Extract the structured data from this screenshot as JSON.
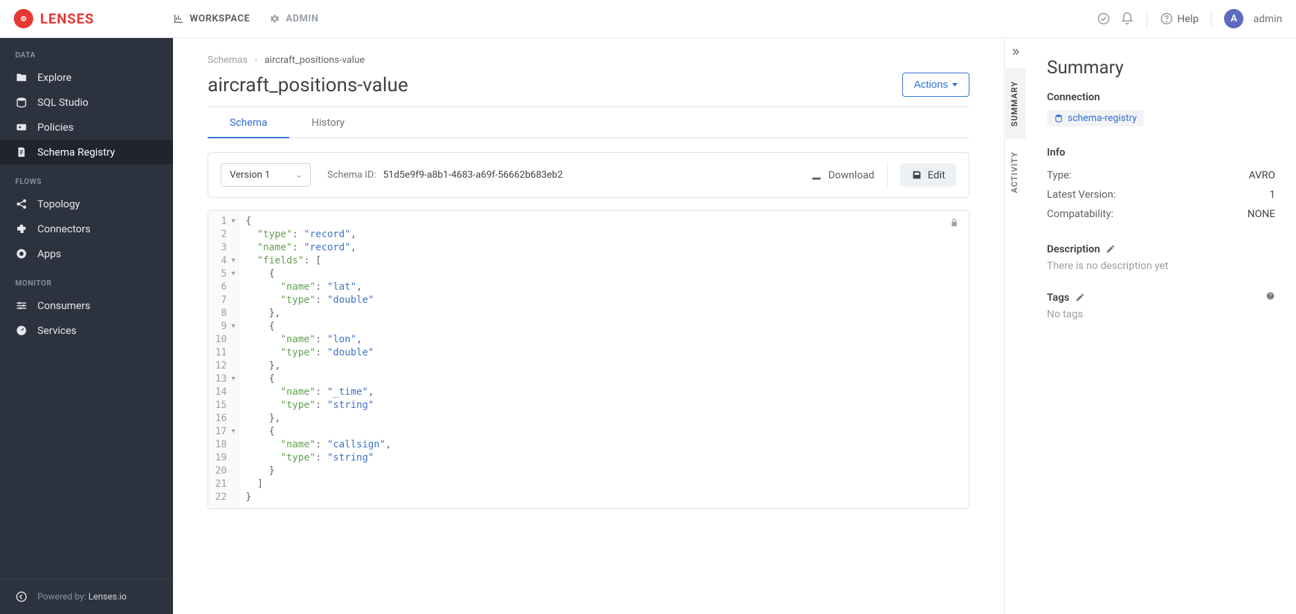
{
  "brand": "LENSES",
  "topnav": {
    "workspace": "WORKSPACE",
    "admin": "ADMIN"
  },
  "topright": {
    "help": "Help",
    "avatar_initial": "A",
    "username": "admin"
  },
  "sidebar": {
    "sections": {
      "data": {
        "title": "DATA",
        "explore": "Explore",
        "sql": "SQL Studio",
        "policies": "Policies",
        "schema": "Schema Registry"
      },
      "flows": {
        "title": "FLOWS",
        "topology": "Topology",
        "connectors": "Connectors",
        "apps": "Apps"
      },
      "monitor": {
        "title": "MONITOR",
        "consumers": "Consumers",
        "services": "Services"
      }
    },
    "footer": {
      "powered": "Powered by: ",
      "brand": "Lenses.io"
    }
  },
  "breadcrumb": {
    "root": "Schemas",
    "current": "aircraft_positions-value"
  },
  "title": "aircraft_positions-value",
  "actions_label": "Actions",
  "tabs": {
    "schema": "Schema",
    "history": "History"
  },
  "toolbar": {
    "version_label": "Version 1",
    "schema_id_label": "Schema ID:",
    "schema_id_value": "51d5e9f9-a8b1-4683-a69f-56662b683eb2",
    "download": "Download",
    "edit": "Edit"
  },
  "rail": {
    "summary": "SUMMARY",
    "activity": "ACTIVITY"
  },
  "panel": {
    "heading": "Summary",
    "connection_label": "Connection",
    "connection_value": "schema-registry",
    "info_label": "Info",
    "info": {
      "type_k": "Type:",
      "type_v": "AVRO",
      "latest_k": "Latest Version:",
      "latest_v": "1",
      "compat_k": "Compatability:",
      "compat_v": "NONE"
    },
    "description_label": "Description",
    "description_empty": "There is no description yet",
    "tags_label": "Tags",
    "tags_empty": "No tags"
  },
  "code": {
    "l1": "{",
    "l2a": "  \"type\"",
    "l2b": ": ",
    "l2c": "\"record\"",
    "l2d": ",",
    "l3a": "  \"name\"",
    "l3b": ": ",
    "l3c": "\"record\"",
    "l3d": ",",
    "l4a": "  \"fields\"",
    "l4b": ": [",
    "l5": "    {",
    "l6a": "      \"name\"",
    "l6b": ": ",
    "l6c": "\"lat\"",
    "l6d": ",",
    "l7a": "      \"type\"",
    "l7b": ": ",
    "l7c": "\"double\"",
    "l8": "    },",
    "l9": "    {",
    "l10a": "      \"name\"",
    "l10b": ": ",
    "l10c": "\"lon\"",
    "l10d": ",",
    "l11a": "      \"type\"",
    "l11b": ": ",
    "l11c": "\"double\"",
    "l12": "    },",
    "l13": "    {",
    "l14a": "      \"name\"",
    "l14b": ": ",
    "l14c": "\"_time\"",
    "l14d": ",",
    "l15a": "      \"type\"",
    "l15b": ": ",
    "l15c": "\"string\"",
    "l16": "    },",
    "l17": "    {",
    "l18a": "      \"name\"",
    "l18b": ": ",
    "l18c": "\"callsign\"",
    "l18d": ",",
    "l19a": "      \"type\"",
    "l19b": ": ",
    "l19c": "\"string\"",
    "l20": "    }",
    "l21": "  ]",
    "l22": "}"
  },
  "line_numbers": [
    "1",
    "2",
    "3",
    "4",
    "5",
    "6",
    "7",
    "8",
    "9",
    "10",
    "11",
    "12",
    "13",
    "14",
    "15",
    "16",
    "17",
    "18",
    "19",
    "20",
    "21",
    "22"
  ]
}
